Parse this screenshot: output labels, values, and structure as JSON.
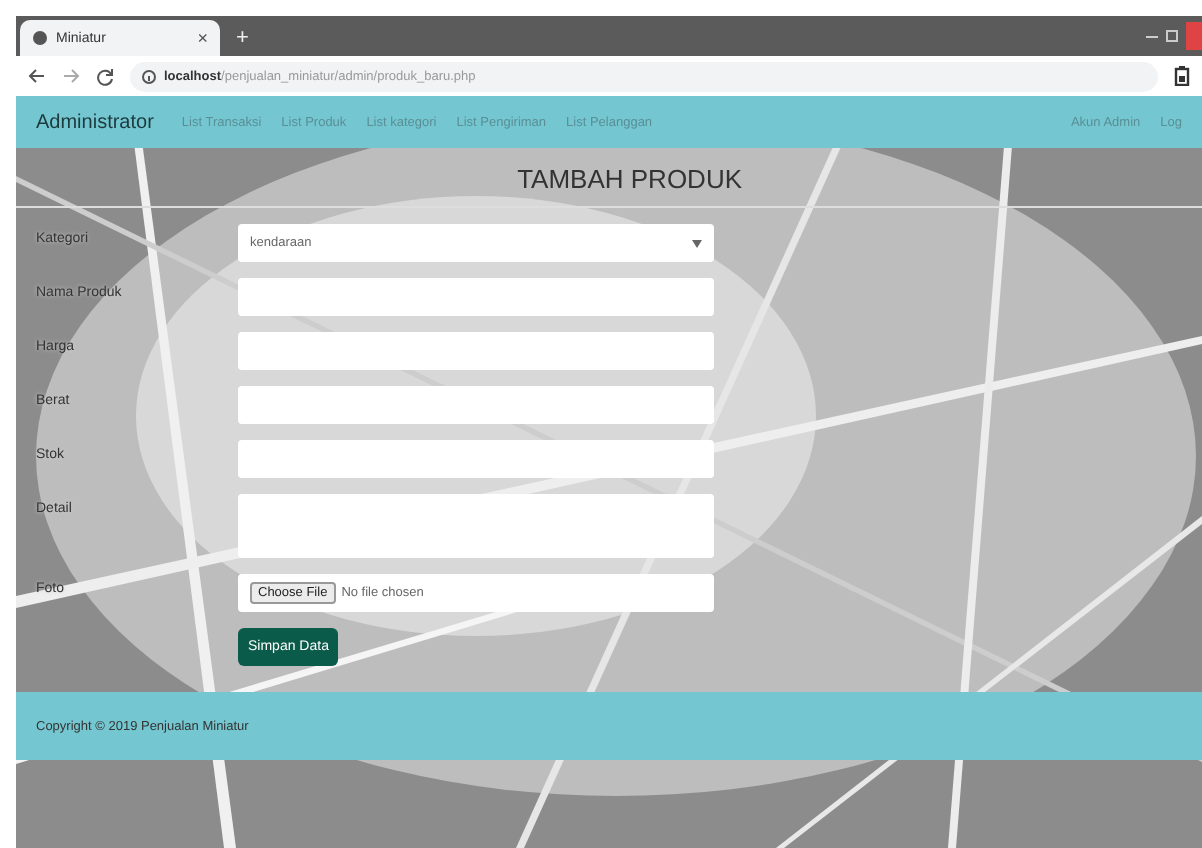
{
  "browser": {
    "tab_title": "Miniatur",
    "tab_close": "×",
    "new_tab": "+",
    "url_host": "localhost",
    "url_path": "/penjualan_miniatur/admin/produk_baru.php"
  },
  "navbar": {
    "brand": "Administrator",
    "links": [
      "List Transaksi",
      "List Produk",
      "List kategori",
      "List Pengiriman",
      "List Pelanggan"
    ],
    "right_links": [
      "Akun Admin",
      "Log"
    ]
  },
  "page": {
    "title": "TAMBAH PRODUK"
  },
  "form": {
    "fields": [
      {
        "label": "Kategori",
        "kind": "select",
        "value": "kendaraan"
      },
      {
        "label": "Nama Produk",
        "kind": "text"
      },
      {
        "label": "Harga",
        "kind": "text"
      },
      {
        "label": "Berat",
        "kind": "text"
      },
      {
        "label": "Stok",
        "kind": "text"
      },
      {
        "label": "Detail",
        "kind": "textarea"
      },
      {
        "label": "Foto",
        "kind": "file",
        "button": "Choose File",
        "status": "No file chosen"
      }
    ],
    "submit": "Simpan Data"
  },
  "footer": {
    "text": "Copyright © 2019 Penjualan Miniatur"
  }
}
